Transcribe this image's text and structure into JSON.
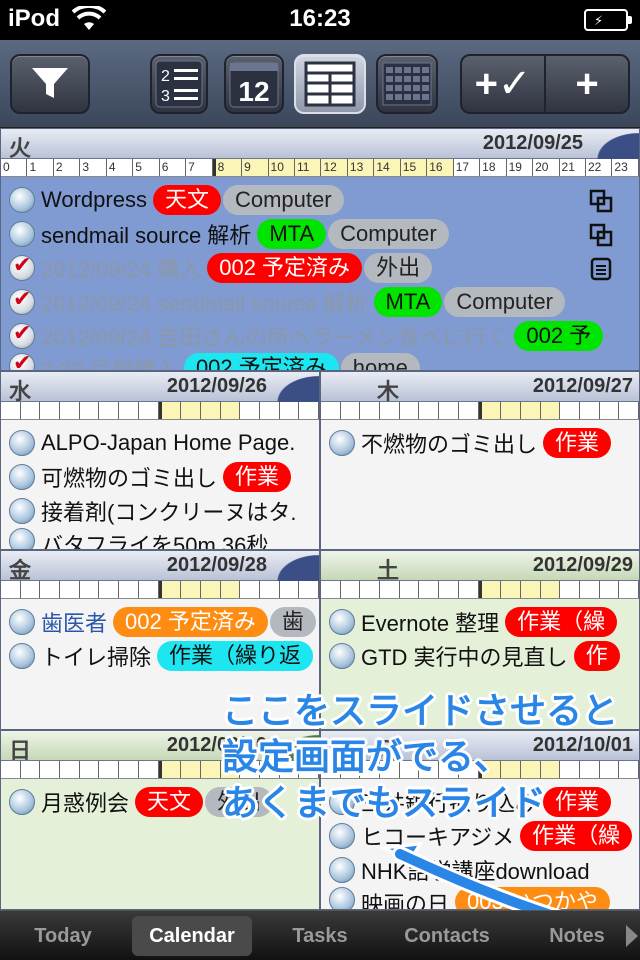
{
  "status_bar": {
    "carrier": "iPod",
    "time": "16:23"
  },
  "toolbar": {
    "calendar_day_number": "12",
    "numbered_list_digits": [
      "2",
      "3"
    ],
    "add_task_label": "+✓",
    "add_label": "+"
  },
  "hours": [
    "0",
    "1",
    "2",
    "3",
    "4",
    "5",
    "6",
    "7",
    "8",
    "9",
    "10",
    "11",
    "12",
    "13",
    "14",
    "15",
    "16",
    "17",
    "18",
    "19",
    "20",
    "21",
    "22",
    "23"
  ],
  "days": {
    "tue": {
      "weekday": "火",
      "date": "2012/09/25",
      "tasks": [
        {
          "title": "Wordpress",
          "tags": [
            "天文",
            "Computer"
          ]
        },
        {
          "title": "sendmail  source   解析",
          "tags": [
            "MTA",
            "Computer"
          ]
        },
        {
          "title": "2012/09/24 購入",
          "tags": [
            "002 予定済み",
            "外出"
          ]
        },
        {
          "title": "2012/09/24 sendmail  source   解析",
          "tags": [
            "MTA",
            "Computer"
          ]
        },
        {
          "title": "2012/09/24 吉田さんの所へラーメン食べに行く",
          "tags": [
            "002 予"
          ]
        },
        {
          "title": "7:30 豆腐購入",
          "tags": [
            "002 予定済み",
            "home"
          ]
        }
      ]
    },
    "wed": {
      "weekday": "水",
      "date": "2012/09/26",
      "tasks": [
        {
          "title": "ALPO-Japan Home Page."
        },
        {
          "title": "可燃物のゴミ出し",
          "tags": [
            "作業"
          ]
        },
        {
          "title": "接着剤(コンクリーヌはタ."
        },
        {
          "title": "バタフライを50m 36秒"
        }
      ]
    },
    "thu": {
      "weekday": "木",
      "date": "2012/09/27",
      "tasks": [
        {
          "title": "不燃物のゴミ出し",
          "tags": [
            "作業"
          ]
        }
      ]
    },
    "fri": {
      "weekday": "金",
      "date": "2012/09/28",
      "tasks": [
        {
          "title": "歯医者",
          "tags": [
            "002 予定済み",
            "歯"
          ]
        },
        {
          "title": "トイレ掃除",
          "tags": [
            "作業（繰り返"
          ]
        }
      ]
    },
    "sat": {
      "weekday": "土",
      "date": "2012/09/29",
      "tasks": [
        {
          "title": "Evernote 整理",
          "tags": [
            "作業（繰"
          ]
        },
        {
          "title": "GTD    実行中の見直し",
          "tags": [
            "作"
          ]
        }
      ]
    },
    "sun": {
      "weekday": "日",
      "date": "2012/09/30",
      "tasks": [
        {
          "title": "月惑例会",
          "tags": [
            "天文",
            "外出"
          ]
        }
      ]
    },
    "mon": {
      "weekday": "月",
      "date": "2012/10/01",
      "tasks": [
        {
          "title": "三井銀行振り込み",
          "tags": [
            "作業"
          ]
        },
        {
          "title": "ヒコーキアジメ",
          "tags": [
            "作業（繰"
          ]
        },
        {
          "title": "NHK語学講座download"
        },
        {
          "title": "映画の日",
          "tags": [
            "003 いつかや"
          ]
        }
      ]
    }
  },
  "annotation": [
    "ここをスライドさせると",
    "設定画面がでる、",
    "あくまでもスライド"
  ],
  "tabbar": {
    "today": "Today",
    "calendar": "Calendar",
    "tasks": "Tasks",
    "contacts": "Contacts",
    "notes": "Notes"
  }
}
